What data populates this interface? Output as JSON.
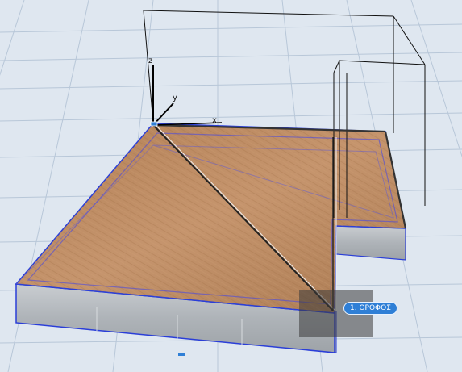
{
  "viewport": {
    "story_label": "1. ΟΡΟΦΟΣ",
    "axes": {
      "x": "x",
      "y": "y",
      "z": "z"
    }
  },
  "colors": {
    "background": "#dfe7f0",
    "grid": "#b8c7d8",
    "floor_wood": "#b9875b",
    "selection_blue": "#2a3ed8",
    "concrete": "#b5b9bd",
    "story_tag": "#2f7fd6"
  }
}
